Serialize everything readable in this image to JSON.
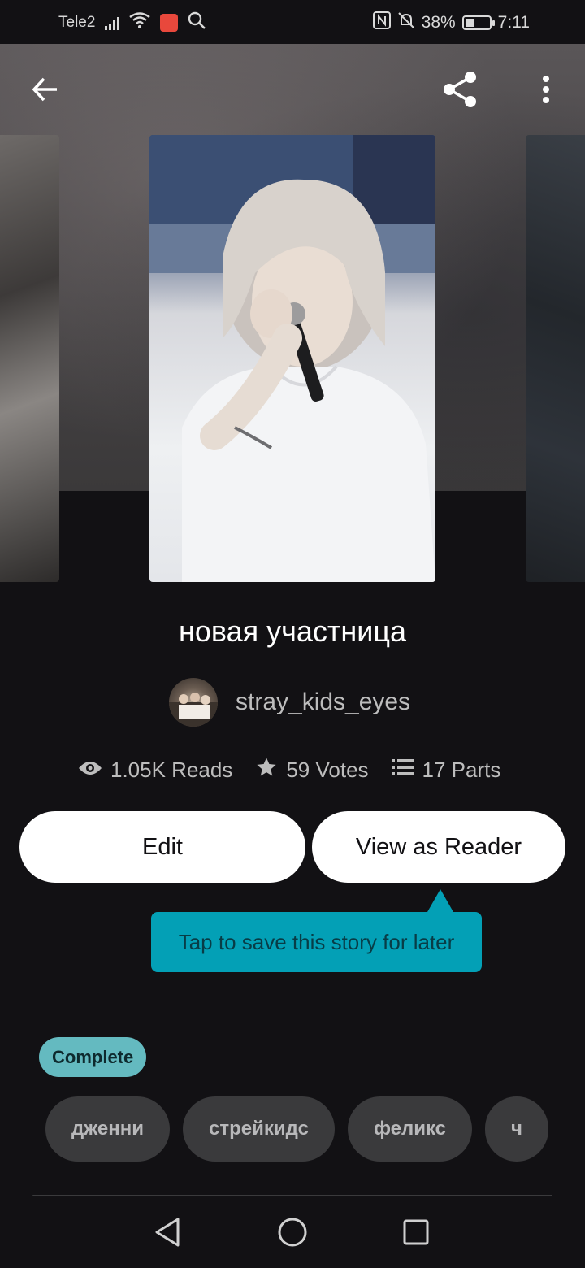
{
  "status_bar": {
    "carrier": "Tele2",
    "battery": "38%",
    "battery_level": 0.38,
    "time": "7:11",
    "icons": [
      "signal-icon",
      "wifi-icon",
      "app-badge-icon",
      "search-icon",
      "nfc-icon",
      "bell-muted-icon",
      "battery-icon"
    ]
  },
  "toolbar": {
    "icons": [
      "back-arrow-icon",
      "share-icon",
      "more-vert-icon"
    ]
  },
  "story": {
    "title": "новая участница",
    "author": "stray_kids_eyes",
    "stats": {
      "reads": "1.05K Reads",
      "votes": "59 Votes",
      "parts": "17 Parts"
    },
    "status": "Complete",
    "tags": [
      "дженни",
      "стрейкидс",
      "феликс",
      "ч"
    ]
  },
  "actions": {
    "edit_label": "Edit",
    "reader_label": "View as Reader"
  },
  "tooltip": {
    "text": "Tap to save this story for later",
    "color": "#03a0b6"
  },
  "nav": {
    "icons": [
      "back-triangle-icon",
      "home-circle-icon",
      "recents-square-icon"
    ]
  }
}
